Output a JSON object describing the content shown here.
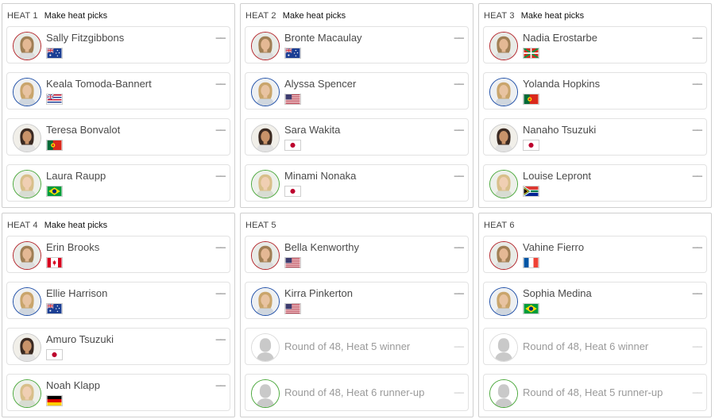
{
  "heats": [
    {
      "label": "HEAT 1",
      "picks_label": "Make heat picks",
      "surfers": [
        {
          "name": "Sally Fitzgibbons",
          "score": "––",
          "flag": "AU",
          "flag_icon": "australia-flag-icon",
          "ring": "red",
          "placeholder": false
        },
        {
          "name": "Keala Tomoda-Bannert",
          "score": "––",
          "flag": "HI",
          "flag_icon": "hawaii-flag-icon",
          "ring": "blue",
          "placeholder": false
        },
        {
          "name": "Teresa Bonvalot",
          "score": "––",
          "flag": "PT",
          "flag_icon": "portugal-flag-icon",
          "ring": "none",
          "placeholder": false
        },
        {
          "name": "Laura Raupp",
          "score": "––",
          "flag": "BR",
          "flag_icon": "brazil-flag-icon",
          "ring": "green",
          "placeholder": false
        }
      ]
    },
    {
      "label": "HEAT 2",
      "picks_label": "Make heat picks",
      "surfers": [
        {
          "name": "Bronte Macaulay",
          "score": "––",
          "flag": "AU",
          "flag_icon": "australia-flag-icon",
          "ring": "red",
          "placeholder": false
        },
        {
          "name": "Alyssa Spencer",
          "score": "––",
          "flag": "US",
          "flag_icon": "usa-flag-icon",
          "ring": "blue",
          "placeholder": false
        },
        {
          "name": "Sara Wakita",
          "score": "––",
          "flag": "JP",
          "flag_icon": "japan-flag-icon",
          "ring": "none",
          "placeholder": false
        },
        {
          "name": "Minami Nonaka",
          "score": "––",
          "flag": "JP",
          "flag_icon": "japan-flag-icon",
          "ring": "green",
          "placeholder": false
        }
      ]
    },
    {
      "label": "HEAT 3",
      "picks_label": "Make heat picks",
      "surfers": [
        {
          "name": "Nadia Erostarbe",
          "score": "––",
          "flag": "EU",
          "flag_icon": "basque-flag-icon",
          "ring": "red",
          "placeholder": false
        },
        {
          "name": "Yolanda Hopkins",
          "score": "––",
          "flag": "PT",
          "flag_icon": "portugal-flag-icon",
          "ring": "blue",
          "placeholder": false
        },
        {
          "name": "Nanaho Tsuzuki",
          "score": "––",
          "flag": "JP",
          "flag_icon": "japan-flag-icon",
          "ring": "none",
          "placeholder": false
        },
        {
          "name": "Louise Lepront",
          "score": "––",
          "flag": "ZA",
          "flag_icon": "south-africa-flag-icon",
          "ring": "green",
          "placeholder": false
        }
      ]
    },
    {
      "label": "HEAT 4",
      "picks_label": "Make heat picks",
      "surfers": [
        {
          "name": "Erin Brooks",
          "score": "––",
          "flag": "CA",
          "flag_icon": "canada-flag-icon",
          "ring": "red",
          "placeholder": false
        },
        {
          "name": "Ellie Harrison",
          "score": "––",
          "flag": "AU",
          "flag_icon": "australia-flag-icon",
          "ring": "blue",
          "placeholder": false
        },
        {
          "name": "Amuro Tsuzuki",
          "score": "––",
          "flag": "JP",
          "flag_icon": "japan-flag-icon",
          "ring": "none",
          "placeholder": false
        },
        {
          "name": "Noah Klapp",
          "score": "––",
          "flag": "DE",
          "flag_icon": "germany-flag-icon",
          "ring": "green",
          "placeholder": false
        }
      ]
    },
    {
      "label": "HEAT 5",
      "picks_label": "",
      "surfers": [
        {
          "name": "Bella Kenworthy",
          "score": "––",
          "flag": "US",
          "flag_icon": "usa-flag-icon",
          "ring": "red",
          "placeholder": false
        },
        {
          "name": "Kirra Pinkerton",
          "score": "––",
          "flag": "US",
          "flag_icon": "usa-flag-icon",
          "ring": "blue",
          "placeholder": false
        },
        {
          "name": "Round of 48, Heat 5 winner",
          "score": "––",
          "flag": "",
          "flag_icon": "",
          "ring": "gray",
          "placeholder": true
        },
        {
          "name": "Round of 48, Heat 6 runner-up",
          "score": "––",
          "flag": "",
          "flag_icon": "",
          "ring": "green",
          "placeholder": true
        }
      ]
    },
    {
      "label": "HEAT 6",
      "picks_label": "",
      "surfers": [
        {
          "name": "Vahine Fierro",
          "score": "––",
          "flag": "FR",
          "flag_icon": "france-flag-icon",
          "ring": "red",
          "placeholder": false
        },
        {
          "name": "Sophia Medina",
          "score": "––",
          "flag": "BR",
          "flag_icon": "brazil-flag-icon",
          "ring": "blue",
          "placeholder": false
        },
        {
          "name": "Round of 48, Heat 6 winner",
          "score": "––",
          "flag": "",
          "flag_icon": "",
          "ring": "gray",
          "placeholder": true
        },
        {
          "name": "Round of 48, Heat 5 runner-up",
          "score": "––",
          "flag": "",
          "flag_icon": "",
          "ring": "green",
          "placeholder": true
        }
      ]
    }
  ],
  "colors": {
    "ring_red": "#b3252b",
    "ring_blue": "#1f4fa8",
    "ring_green": "#4aa83b",
    "ring_gray": "#dcdcdc",
    "placeholder_text": "#9a9a9a"
  }
}
